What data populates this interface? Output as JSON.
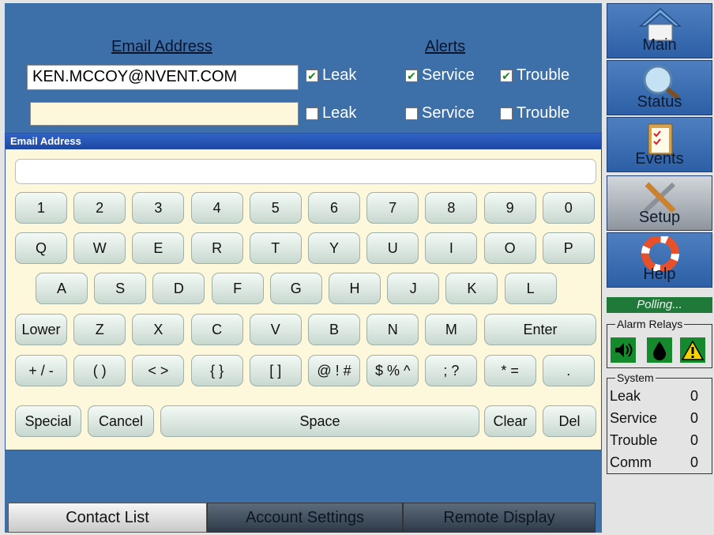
{
  "contacts": {
    "email_header": "Email Address",
    "alerts_header": "Alerts",
    "rows": [
      {
        "email": "KEN.MCCOY@NVENT.COM",
        "leak": true,
        "service": true,
        "trouble": true
      },
      {
        "email": "",
        "leak": false,
        "service": false,
        "trouble": false
      }
    ],
    "labels": {
      "leak": "Leak",
      "service": "Service",
      "trouble": "Trouble"
    }
  },
  "keyboard": {
    "title": "Email Address",
    "input_value": "",
    "row1": [
      "1",
      "2",
      "3",
      "4",
      "5",
      "6",
      "7",
      "8",
      "9",
      "0"
    ],
    "row2": [
      "Q",
      "W",
      "E",
      "R",
      "T",
      "Y",
      "U",
      "I",
      "O",
      "P"
    ],
    "row3": [
      "A",
      "S",
      "D",
      "F",
      "G",
      "H",
      "J",
      "K",
      "L"
    ],
    "row4": [
      "Lower",
      "Z",
      "X",
      "C",
      "V",
      "B",
      "N",
      "M",
      "Enter"
    ],
    "row5": [
      "+ / -",
      "( )",
      "< >",
      "{ }",
      "[ ]",
      "@ ! #",
      "$ % ^",
      "; ?",
      "* =",
      "."
    ],
    "row6": [
      "Special",
      "Cancel",
      "Space",
      "Clear",
      "Del"
    ]
  },
  "tabs": [
    "Contact List",
    "Account Settings",
    "Remote Display"
  ],
  "nav": [
    {
      "label": "Main",
      "icon": "house-icon"
    },
    {
      "label": "Status",
      "icon": "magnifier-icon"
    },
    {
      "label": "Events",
      "icon": "clipboard-icon"
    },
    {
      "label": "Setup",
      "icon": "tools-icon"
    },
    {
      "label": "Help",
      "icon": "lifebuoy-icon"
    }
  ],
  "status": {
    "polling": "Polling...",
    "alarm_relays_title": "Alarm Relays",
    "relays": [
      "speaker-icon",
      "drop-icon",
      "warning-icon"
    ],
    "system_title": "System",
    "system": [
      {
        "label": "Leak",
        "value": "0"
      },
      {
        "label": "Service",
        "value": "0"
      },
      {
        "label": "Trouble",
        "value": "0"
      },
      {
        "label": "Comm",
        "value": "0"
      }
    ]
  },
  "colors": {
    "panel": "#3d6fa8",
    "keyboard_bg": "#fdf8dc",
    "polling_bg": "#1f7a3a",
    "relay_bg": "#148a2c"
  }
}
